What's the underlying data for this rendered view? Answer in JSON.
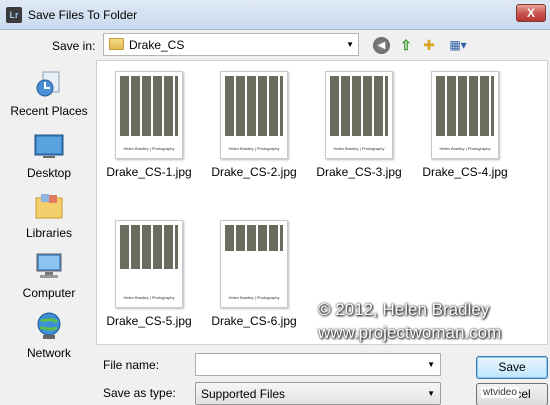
{
  "window": {
    "title": "Save Files To Folder",
    "app_icon": "Lr",
    "close_label": "X"
  },
  "toolbar": {
    "save_in_label": "Save in:",
    "save_in_value": "Drake_CS"
  },
  "places": [
    {
      "label": "Recent Places",
      "icon": "recent-places-icon"
    },
    {
      "label": "Desktop",
      "icon": "desktop-icon"
    },
    {
      "label": "Libraries",
      "icon": "libraries-icon"
    },
    {
      "label": "Computer",
      "icon": "computer-icon"
    },
    {
      "label": "Network",
      "icon": "network-icon"
    }
  ],
  "files": [
    {
      "name": "Drake_CS-1.jpg",
      "caption": "Helen Bradley | Photography"
    },
    {
      "name": "Drake_CS-2.jpg",
      "caption": "Helen Bradley | Photography"
    },
    {
      "name": "Drake_CS-3.jpg",
      "caption": "Helen Bradley | Photography"
    },
    {
      "name": "Drake_CS-4.jpg",
      "caption": "Helen Bradley | Photography"
    },
    {
      "name": "Drake_CS-5.jpg",
      "caption": "Helen Bradley | Photography"
    },
    {
      "name": "Drake_CS-6.jpg",
      "caption": "Helen Bradley | Photography"
    }
  ],
  "watermark": {
    "line1": "© 2012, Helen Bradley",
    "line2": "www.projectwoman.com"
  },
  "footer": {
    "file_name_label": "File name:",
    "file_name_value": "",
    "save_as_type_label": "Save as type:",
    "save_as_type_value": "Supported Files",
    "save_label": "Save",
    "cancel_label": "Cancel",
    "tag": "wtvideo"
  },
  "colors": {
    "accent": "#3c7fb1",
    "close": "#c75050"
  }
}
